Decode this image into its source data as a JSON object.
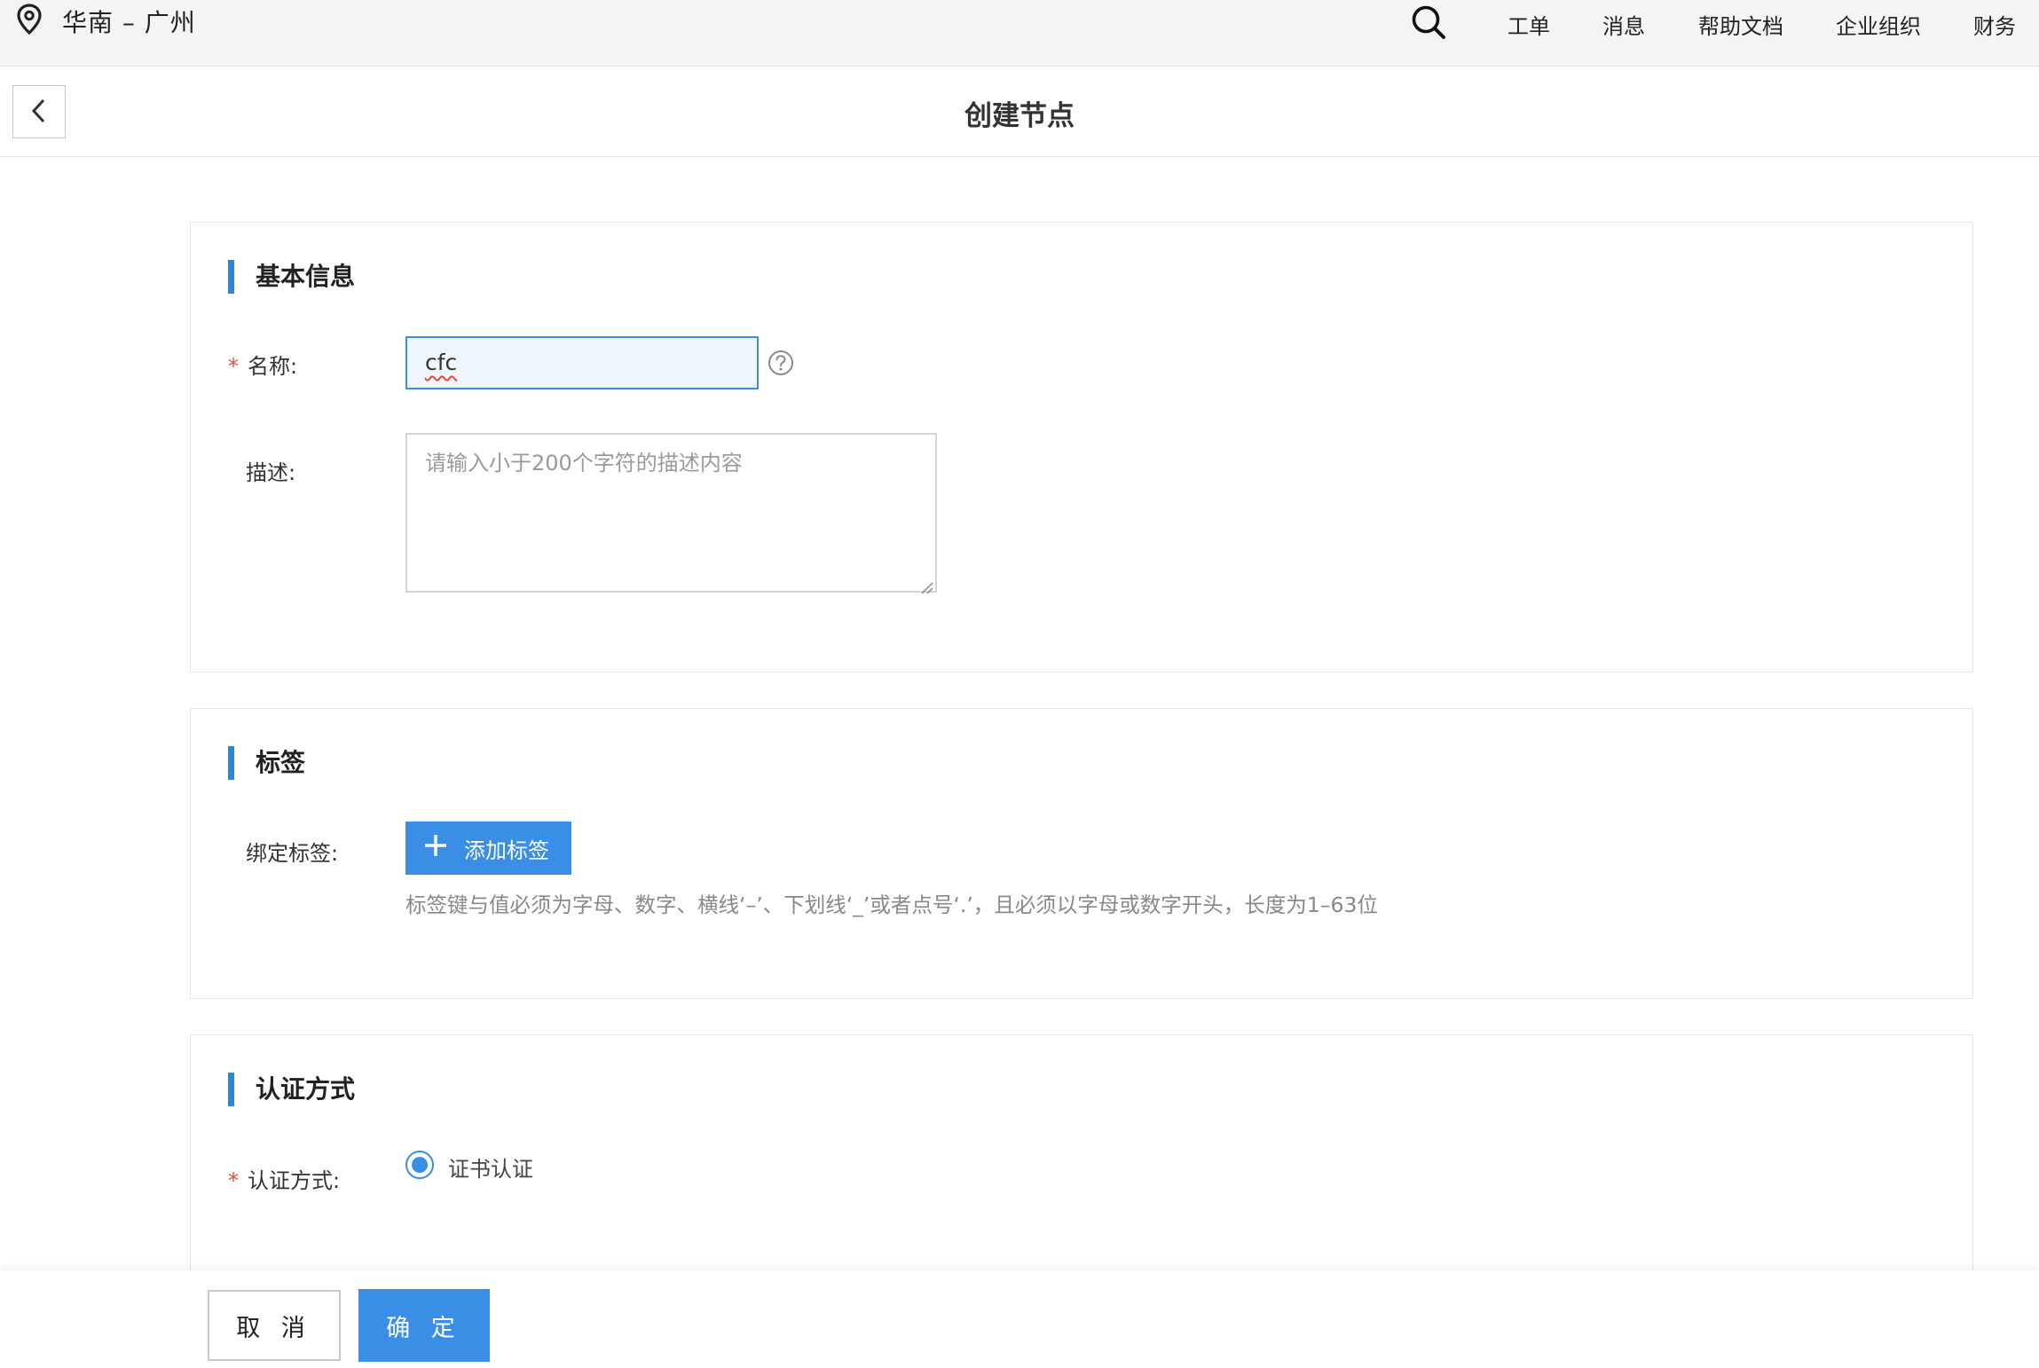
{
  "topbar": {
    "region": "华南 – 广州",
    "region_icon": "location-pin-icon",
    "search_icon": "search-icon",
    "nav": [
      "工单",
      "消息",
      "帮助文档",
      "企业组织",
      "财务"
    ]
  },
  "page": {
    "title": "创建节点",
    "back_icon": "chevron-left-icon"
  },
  "basic_info": {
    "title": "基本信息",
    "name_label": "名称:",
    "name_value": "cfc",
    "help_icon": "question-circle-icon",
    "desc_label": "描述:",
    "desc_placeholder": "请输入小于200个字符的描述内容"
  },
  "tags": {
    "title": "标签",
    "bind_label": "绑定标签:",
    "add_button": "添加标签",
    "hint": "标签键与值必须为字母、数字、横线‘–’、下划线‘_’或者点号‘.’，且必须以字母或数字开头，长度为1–63位"
  },
  "auth": {
    "title": "认证方式",
    "method_label": "认证方式:",
    "option": "证书认证",
    "selected": true
  },
  "footer": {
    "cancel": "取 消",
    "confirm": "确 定"
  },
  "colors": {
    "accent": "#3a8ee6",
    "required": "#e24a40"
  }
}
